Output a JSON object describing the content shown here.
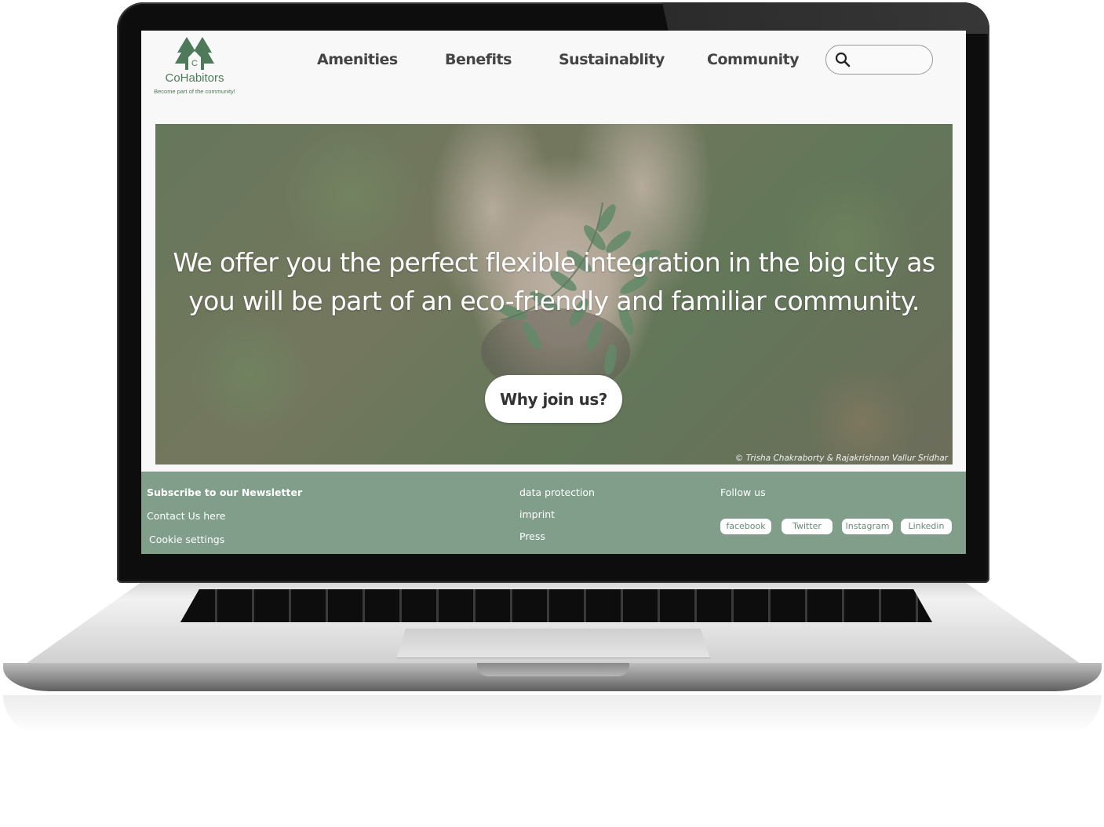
{
  "brand": {
    "name": "CoHabitors",
    "tagline": "Become part of the community!",
    "logo_letter": "C",
    "logo_color": "#4f7a5a"
  },
  "nav": {
    "items": [
      {
        "label": "Amenities"
      },
      {
        "label": "Benefits"
      },
      {
        "label": "Sustainablity"
      },
      {
        "label": "Community"
      }
    ]
  },
  "search": {
    "icon": "search-icon",
    "placeholder": ""
  },
  "hero": {
    "line1": "We offer you the perfect flexible integration in the big city as",
    "line2": "you will be part of an eco-friendly and familiar community.",
    "cta_label": "Why join us?",
    "credit": "© Trisha Chakraborty & Rajakrishnan Vallur Sridhar"
  },
  "footer": {
    "newsletter": "Subscribe to our Newsletter",
    "contact": "Contact Us here",
    "cookies": "Cookie settings",
    "data_protection": "data protection",
    "imprint": "imprint",
    "press": "Press",
    "follow": "Follow us",
    "social": [
      {
        "label": "facebook"
      },
      {
        "label": "Twitter"
      },
      {
        "label": "Instagram"
      },
      {
        "label": "Linkedin"
      }
    ],
    "bg_color": "#809e89"
  }
}
